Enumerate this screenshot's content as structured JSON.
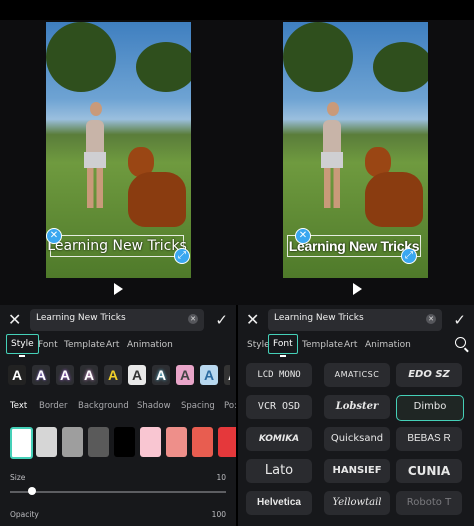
{
  "caption": "Learning New Tricks",
  "left_panel": {
    "text_value": "Learning New Tricks",
    "tabs": [
      "Style",
      "Font",
      "Template",
      "Art",
      "Animation"
    ],
    "active_tab": "Style",
    "style_presets": [
      "A",
      "A",
      "A",
      "A",
      "A",
      "A",
      "A",
      "A",
      "A",
      "A"
    ],
    "subtabs": [
      "Text",
      "Border",
      "Background",
      "Shadow",
      "Spacing",
      "Po:"
    ],
    "active_subtab": "Text",
    "colors": [
      "#ffffff",
      "#d6d6d6",
      "#9e9e9e",
      "#5a5a5a",
      "#000000",
      "#f9c6d2",
      "#ee8f8a",
      "#e85d50",
      "#e5383b"
    ],
    "size_label": "Size",
    "size_value": "10",
    "size_fraction": 0.1,
    "opacity_label": "Opacity",
    "opacity_value": "100"
  },
  "right_panel": {
    "text_value": "Learning New Tricks",
    "tabs": [
      "Style",
      "Font",
      "Template",
      "Art",
      "Animation"
    ],
    "active_tab": "Font",
    "fonts": [
      "LCD MONO",
      "AMATICSC",
      "EDO SZ",
      "VCR OSD",
      "Lobster",
      "Dimbo",
      "KOMIKA",
      "Quicksand",
      "BEBAS R",
      "Lato",
      "HANSIEF",
      "CUNIA",
      "Helvetica",
      "Yellowtail",
      "Roboto T"
    ],
    "selected_font": "Dimbo"
  }
}
